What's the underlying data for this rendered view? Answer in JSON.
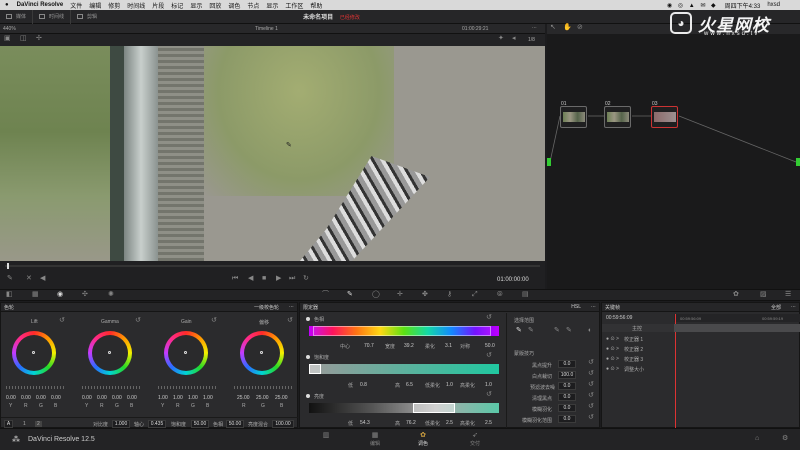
{
  "menubar": {
    "app": "DaVinci Resolve",
    "items": [
      "文件",
      "编辑",
      "修剪",
      "时间线",
      "片段",
      "标记",
      "显示",
      "回放",
      "调色",
      "节点",
      "显示",
      "工作区",
      "帮助"
    ],
    "clock": "周四下午4:33",
    "user": "hxsd"
  },
  "toolbar": {
    "media": "媒体",
    "timeline": "时间线",
    "clips": "剪辑",
    "project_title": "未命名项目",
    "modified": "已经修改"
  },
  "viewer": {
    "zoom": "440%",
    "timeline": "Timeline 1",
    "timecode_top": "01:00:29:21",
    "timecode_bottom": "01:00:00:00",
    "clip": "1/8"
  },
  "watermark": {
    "brand": "火星网校",
    "url": "www.hxsd.tv"
  },
  "nodes": [
    {
      "label": "01"
    },
    {
      "label": "02"
    },
    {
      "label": "03"
    }
  ],
  "color_wheels": {
    "title": "色轮",
    "mode": "一级校色轮",
    "wheels": [
      {
        "name": "Lift",
        "values": [
          "0.00",
          "0.00",
          "0.00",
          "0.00"
        ],
        "channels": [
          "Y",
          "R",
          "G",
          "B"
        ]
      },
      {
        "name": "Gamma",
        "values": [
          "0.00",
          "0.00",
          "0.00",
          "0.00"
        ],
        "channels": [
          "Y",
          "R",
          "G",
          "B"
        ]
      },
      {
        "name": "Gain",
        "values": [
          "1.00",
          "1.00",
          "1.00",
          "1.00"
        ],
        "channels": [
          "Y",
          "R",
          "G",
          "B"
        ]
      },
      {
        "name": "偏移",
        "values": [
          "25.00",
          "25.00",
          "25.00"
        ],
        "channels": [
          "R",
          "G",
          "B"
        ]
      }
    ],
    "footer": {
      "auto": "A",
      "p1": "1",
      "p2": "2",
      "contrast_label": "对比度",
      "contrast": "1.000",
      "pivot_label": "轴心",
      "pivot": "0.435",
      "sat_label": "饱和度",
      "sat": "50.00",
      "hue_label": "色相",
      "hue": "50.00",
      "lum_label": "亮度混合",
      "lum": "100.00"
    }
  },
  "qualifier": {
    "title": "限定器",
    "hue_label": "色相",
    "hue_vals": [
      {
        "l": "中心",
        "v": "70.7"
      },
      {
        "l": "宽度",
        "v": "39.2"
      },
      {
        "l": "柔化",
        "v": "3.1"
      },
      {
        "l": "对称",
        "v": "50.0"
      }
    ],
    "sat_label": "饱和度",
    "sat_vals": [
      {
        "l": "低",
        "v": "0.8"
      },
      {
        "l": "高",
        "v": "6.5"
      },
      {
        "l": "低柔化",
        "v": "1.0"
      },
      {
        "l": "高柔化",
        "v": "1.0"
      }
    ],
    "lum_label": "亮度",
    "lum_vals": [
      {
        "l": "低",
        "v": "54.3"
      },
      {
        "l": "高",
        "v": "76.2"
      },
      {
        "l": "低柔化",
        "v": "2.5"
      },
      {
        "l": "高柔化",
        "v": "2.5"
      }
    ],
    "select_title": "选择范围",
    "refine_title": "蒙版技巧",
    "hsl": "HSL",
    "refine": [
      {
        "l": "黑点提升",
        "v": "0.0"
      },
      {
        "l": "白点裁切",
        "v": "100.0"
      },
      {
        "l": "预滤波去噪",
        "v": "0.0"
      },
      {
        "l": "清理黑点",
        "v": "0.0"
      },
      {
        "l": "模糊羽化",
        "v": "0.0"
      },
      {
        "l": "模糊羽化范围",
        "v": "0.0"
      },
      {
        "l": "黑白校准",
        "v": "0.0"
      }
    ]
  },
  "keyframes": {
    "title": "关键帧",
    "all": "全部",
    "tc_left": "00:59:56:09",
    "tc_a": "00:59:56:09",
    "tc_b": "00:59:59:19",
    "master": "主控",
    "rows": [
      "校正器 1",
      "校正器 2",
      "校正器 3",
      "调整大小"
    ]
  },
  "pages": {
    "app_name": "DaVinci Resolve 12.5",
    "edit": "编辑",
    "color": "调色",
    "deliver": "交付"
  }
}
